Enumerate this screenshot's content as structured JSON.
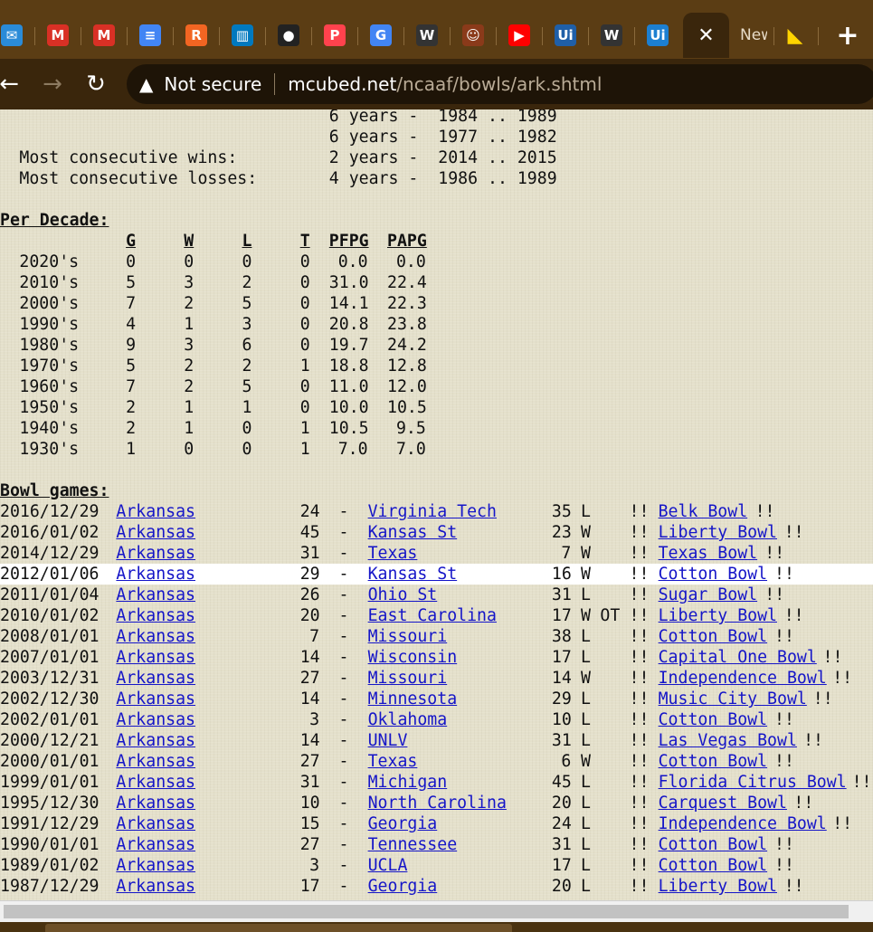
{
  "browser": {
    "tabs": [
      {
        "icon": "mailbox-icon",
        "glyph": "✉",
        "color": "#2a8bd8"
      },
      {
        "icon": "gmail-icon",
        "glyph": "M",
        "color": "#d93025"
      },
      {
        "icon": "gmail-icon",
        "glyph": "M",
        "color": "#d93025"
      },
      {
        "icon": "docs-icon",
        "glyph": "≡",
        "color": "#4285f4"
      },
      {
        "icon": "r-app-icon",
        "glyph": "R",
        "color": "#f26522"
      },
      {
        "icon": "trello-icon",
        "glyph": "▥",
        "color": "#0079bf"
      },
      {
        "icon": "github-icon",
        "glyph": "●",
        "color": "#222222"
      },
      {
        "icon": "patreon-icon",
        "glyph": "P",
        "color": "#ff424d"
      },
      {
        "icon": "google-icon",
        "glyph": "G",
        "color": "#4285f4"
      },
      {
        "icon": "wikipedia-icon",
        "glyph": "W",
        "color": "#333333"
      },
      {
        "icon": "avatar-icon",
        "glyph": "☺",
        "color": "#8a3a1a"
      },
      {
        "icon": "youtube-icon",
        "glyph": "▶",
        "color": "#ff0000"
      },
      {
        "icon": "ui-icon",
        "glyph": "Ui",
        "color": "#1f5fa8"
      },
      {
        "icon": "wikipedia-icon",
        "glyph": "W",
        "color": "#333333"
      },
      {
        "icon": "ui-icon",
        "glyph": "Ui",
        "color": "#1c7fd1"
      }
    ],
    "active_tab_close": "✕",
    "new_tab_label": "New Tab",
    "last_tab_glyph": "◣",
    "new_tab_button": "+",
    "nav": {
      "back": "←",
      "forward": "→",
      "reload": "↻"
    },
    "security_label": "Not secure",
    "url_host": "mcubed.net",
    "url_path": "/ncaaf/bowls/ark.shtml"
  },
  "streaks": [
    {
      "label": "",
      "years": "6 years -  1984 .. 1989"
    },
    {
      "label": "",
      "years": "6 years -  1977 .. 1982"
    },
    {
      "label": "Most consecutive wins:",
      "years": "2 years -  2014 .. 2015"
    },
    {
      "label": "Most consecutive losses:",
      "years": "4 years -  1986 .. 1989"
    }
  ],
  "per_decade": {
    "heading": "Per Decade:",
    "columns": [
      "G",
      "W",
      "L",
      "T",
      "PFPG",
      "PAPG"
    ],
    "rows": [
      [
        "2020's",
        "0",
        "0",
        "0",
        "0",
        "0.0",
        "0.0"
      ],
      [
        "2010's",
        "5",
        "3",
        "2",
        "0",
        "31.0",
        "22.4"
      ],
      [
        "2000's",
        "7",
        "2",
        "5",
        "0",
        "14.1",
        "22.3"
      ],
      [
        "1990's",
        "4",
        "1",
        "3",
        "0",
        "20.8",
        "23.8"
      ],
      [
        "1980's",
        "9",
        "3",
        "6",
        "0",
        "19.7",
        "24.2"
      ],
      [
        "1970's",
        "5",
        "2",
        "2",
        "1",
        "18.8",
        "12.8"
      ],
      [
        "1960's",
        "7",
        "2",
        "5",
        "0",
        "11.0",
        "12.0"
      ],
      [
        "1950's",
        "2",
        "1",
        "1",
        "0",
        "10.0",
        "10.5"
      ],
      [
        "1940's",
        "2",
        "1",
        "0",
        "1",
        "10.5",
        "9.5"
      ],
      [
        "1930's",
        "1",
        "0",
        "0",
        "1",
        "7.0",
        "7.0"
      ]
    ]
  },
  "bowl_games": {
    "heading": "Bowl games:",
    "separator": "-",
    "bang": "!!",
    "rows": [
      {
        "date": "2016/12/29",
        "team": "Arkansas",
        "pts": "24",
        "opp": "Virginia Tech",
        "opp_pts": "35",
        "res": "L",
        "ot": "",
        "bowl": "Belk Bowl"
      },
      {
        "date": "2016/01/02",
        "team": "Arkansas",
        "pts": "45",
        "opp": "Kansas St",
        "opp_pts": "23",
        "res": "W",
        "ot": "",
        "bowl": "Liberty Bowl"
      },
      {
        "date": "2014/12/29",
        "team": "Arkansas",
        "pts": "31",
        "opp": "Texas",
        "opp_pts": "7",
        "res": "W",
        "ot": "",
        "bowl": "Texas Bowl"
      },
      {
        "date": "2012/01/06",
        "team": "Arkansas",
        "pts": "29",
        "opp": "Kansas St",
        "opp_pts": "16",
        "res": "W",
        "ot": "",
        "bowl": "Cotton Bowl"
      },
      {
        "date": "2011/01/04",
        "team": "Arkansas",
        "pts": "26",
        "opp": "Ohio St",
        "opp_pts": "31",
        "res": "L",
        "ot": "",
        "bowl": "Sugar Bowl"
      },
      {
        "date": "2010/01/02",
        "team": "Arkansas",
        "pts": "20",
        "opp": "East Carolina",
        "opp_pts": "17",
        "res": "W",
        "ot": "OT",
        "bowl": "Liberty Bowl"
      },
      {
        "date": "2008/01/01",
        "team": "Arkansas",
        "pts": "7",
        "opp": "Missouri",
        "opp_pts": "38",
        "res": "L",
        "ot": "",
        "bowl": "Cotton Bowl"
      },
      {
        "date": "2007/01/01",
        "team": "Arkansas",
        "pts": "14",
        "opp": "Wisconsin",
        "opp_pts": "17",
        "res": "L",
        "ot": "",
        "bowl": "Capital One Bowl"
      },
      {
        "date": "2003/12/31",
        "team": "Arkansas",
        "pts": "27",
        "opp": "Missouri",
        "opp_pts": "14",
        "res": "W",
        "ot": "",
        "bowl": "Independence Bowl"
      },
      {
        "date": "2002/12/30",
        "team": "Arkansas",
        "pts": "14",
        "opp": "Minnesota",
        "opp_pts": "29",
        "res": "L",
        "ot": "",
        "bowl": "Music City Bowl"
      },
      {
        "date": "2002/01/01",
        "team": "Arkansas",
        "pts": "3",
        "opp": "Oklahoma",
        "opp_pts": "10",
        "res": "L",
        "ot": "",
        "bowl": "Cotton Bowl"
      },
      {
        "date": "2000/12/21",
        "team": "Arkansas",
        "pts": "14",
        "opp": "UNLV",
        "opp_pts": "31",
        "res": "L",
        "ot": "",
        "bowl": "Las Vegas Bowl"
      },
      {
        "date": "2000/01/01",
        "team": "Arkansas",
        "pts": "27",
        "opp": "Texas",
        "opp_pts": "6",
        "res": "W",
        "ot": "",
        "bowl": "Cotton Bowl"
      },
      {
        "date": "1999/01/01",
        "team": "Arkansas",
        "pts": "31",
        "opp": "Michigan",
        "opp_pts": "45",
        "res": "L",
        "ot": "",
        "bowl": "Florida Citrus Bowl"
      },
      {
        "date": "1995/12/30",
        "team": "Arkansas",
        "pts": "10",
        "opp": "North Carolina",
        "opp_pts": "20",
        "res": "L",
        "ot": "",
        "bowl": "Carquest Bowl"
      },
      {
        "date": "1991/12/29",
        "team": "Arkansas",
        "pts": "15",
        "opp": "Georgia",
        "opp_pts": "24",
        "res": "L",
        "ot": "",
        "bowl": "Independence Bowl"
      },
      {
        "date": "1990/01/01",
        "team": "Arkansas",
        "pts": "27",
        "opp": "Tennessee",
        "opp_pts": "31",
        "res": "L",
        "ot": "",
        "bowl": "Cotton Bowl"
      },
      {
        "date": "1989/01/02",
        "team": "Arkansas",
        "pts": "3",
        "opp": "UCLA",
        "opp_pts": "17",
        "res": "L",
        "ot": "",
        "bowl": "Cotton Bowl"
      },
      {
        "date": "1987/12/29",
        "team": "Arkansas",
        "pts": "17",
        "opp": "Georgia",
        "opp_pts": "20",
        "res": "L",
        "ot": "",
        "bowl": "Liberty Bowl"
      }
    ]
  }
}
